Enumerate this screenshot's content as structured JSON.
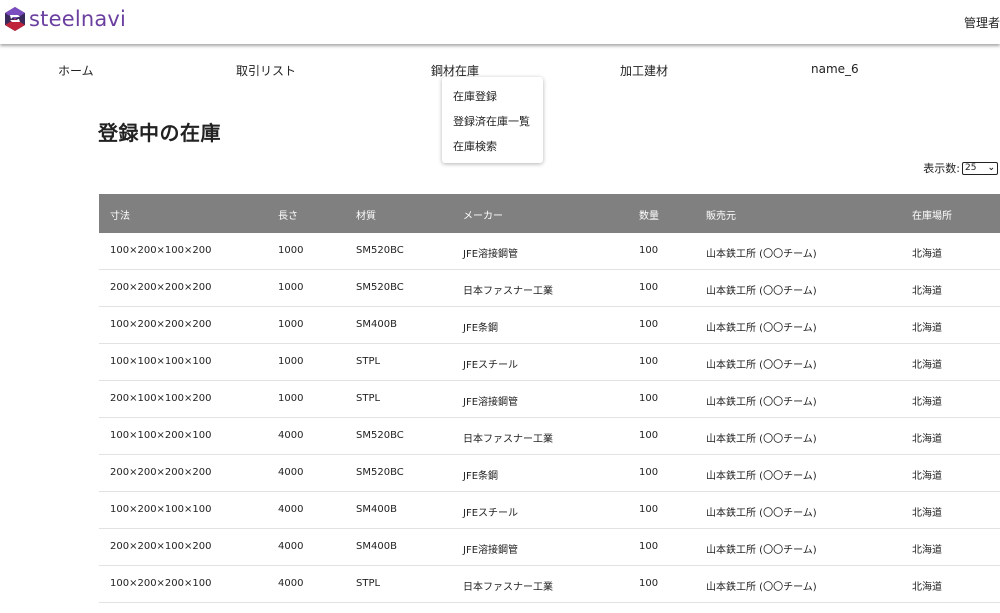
{
  "header": {
    "logo_text": "steelnavi",
    "user_label": "管理者"
  },
  "nav": {
    "items": [
      "ホーム",
      "取引リスト",
      "鋼材在庫",
      "加工建材",
      "name_6"
    ]
  },
  "dropdown": {
    "items": [
      "在庫登録",
      "登録済在庫一覧",
      "在庫検索"
    ]
  },
  "page": {
    "title": "登録中の在庫",
    "per_page_label": "表示数:",
    "per_page_value": "25"
  },
  "table": {
    "columns": [
      "寸法",
      "長さ",
      "材質",
      "メーカー",
      "数量",
      "販売元",
      "在庫場所"
    ],
    "rows": [
      [
        "100×200×100×200",
        "1000",
        "SM520BC",
        "JFE溶接鋼管",
        "100",
        "山本鉄工所 (〇〇チーム)",
        "北海道"
      ],
      [
        "200×200×200×200",
        "1000",
        "SM520BC",
        "日本ファスナー工業",
        "100",
        "山本鉄工所 (〇〇チーム)",
        "北海道"
      ],
      [
        "100×200×200×200",
        "1000",
        "SM400B",
        "JFE条鋼",
        "100",
        "山本鉄工所 (〇〇チーム)",
        "北海道"
      ],
      [
        "100×100×100×100",
        "1000",
        "STPL",
        "JFEスチール",
        "100",
        "山本鉄工所 (〇〇チーム)",
        "北海道"
      ],
      [
        "200×100×100×200",
        "1000",
        "STPL",
        "JFE溶接鋼管",
        "100",
        "山本鉄工所 (〇〇チーム)",
        "北海道"
      ],
      [
        "100×100×200×100",
        "4000",
        "SM520BC",
        "日本ファスナー工業",
        "100",
        "山本鉄工所 (〇〇チーム)",
        "北海道"
      ],
      [
        "200×200×200×200",
        "4000",
        "SM520BC",
        "JFE条鋼",
        "100",
        "山本鉄工所 (〇〇チーム)",
        "北海道"
      ],
      [
        "100×200×100×100",
        "4000",
        "SM400B",
        "JFEスチール",
        "100",
        "山本鉄工所 (〇〇チーム)",
        "北海道"
      ],
      [
        "200×200×100×200",
        "4000",
        "SM400B",
        "JFE溶接鋼管",
        "100",
        "山本鉄工所 (〇〇チーム)",
        "北海道"
      ],
      [
        "100×200×200×100",
        "4000",
        "STPL",
        "日本ファスナー工業",
        "100",
        "山本鉄工所 (〇〇チーム)",
        "北海道"
      ]
    ]
  },
  "colors": {
    "brand": "#6b3fa0",
    "table_header": "#808080"
  }
}
